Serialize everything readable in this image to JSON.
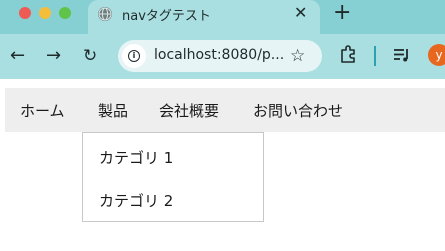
{
  "tab": {
    "title": "navタグテスト",
    "close_glyph": "✕",
    "favicon": "globe-icon"
  },
  "newtab_glyph": "+",
  "toolbar": {
    "back_glyph": "←",
    "forward_glyph": "→",
    "reload_glyph": "↻",
    "url": "localhost:8080/p...",
    "info_glyph": "i",
    "star_glyph": "☆",
    "avatar_letter": "y"
  },
  "colors": {
    "tabstrip": "#86cfd3",
    "toolbar": "#aadfe1",
    "navbar": "#eeeeee",
    "avatar": "#e8671e"
  },
  "nav": {
    "items": [
      {
        "label": "ホーム"
      },
      {
        "label": "製品"
      },
      {
        "label": "会社概要"
      },
      {
        "label": "お問い合わせ"
      }
    ],
    "dropdown": [
      {
        "label": "カテゴリ 1"
      },
      {
        "label": "カテゴリ 2"
      }
    ]
  }
}
